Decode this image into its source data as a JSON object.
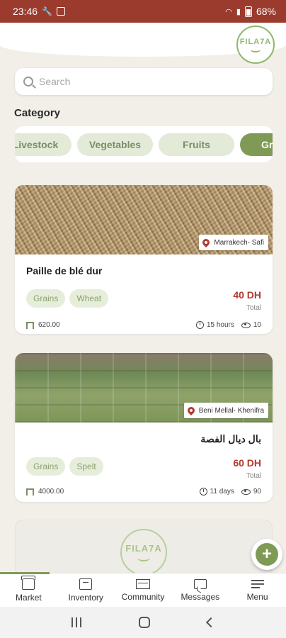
{
  "status_bar": {
    "time": "23:46",
    "battery": "68%"
  },
  "header": {
    "logo_text": "FILA7A"
  },
  "search": {
    "placeholder": "Search"
  },
  "category": {
    "title": "Category",
    "chips": [
      {
        "label": "Livestock",
        "active": false
      },
      {
        "label": "Vegetables",
        "active": false
      },
      {
        "label": "Fruits",
        "active": false
      },
      {
        "label": "Gr",
        "active": true
      }
    ]
  },
  "listings": [
    {
      "location": "Marrakech- Safi",
      "title": "Paille de blé dur",
      "tags": [
        "Grains",
        "Wheat"
      ],
      "price": "40 DH",
      "price_label": "Total",
      "quantity": "620.00",
      "time_ago": "15 hours",
      "views": "10"
    },
    {
      "location": "Beni Mellal- Khenifra",
      "title": "بال ديال الفصة",
      "tags": [
        "Grains",
        "Spelt"
      ],
      "price": "60 DH",
      "price_label": "Total",
      "quantity": "4000.00",
      "time_ago": "11 days",
      "views": "90"
    }
  ],
  "placeholder_card": {
    "logo_text": "FILA7A"
  },
  "fab": {
    "label": "+"
  },
  "bottom_nav": {
    "items": [
      {
        "label": "Market"
      },
      {
        "label": "Inventory"
      },
      {
        "label": "Community"
      },
      {
        "label": "Messages"
      },
      {
        "label": "Menu"
      }
    ]
  },
  "colors": {
    "status_bar": "#9b3b2e",
    "accent_green": "#7f9a55",
    "price_red": "#b23a2e"
  }
}
